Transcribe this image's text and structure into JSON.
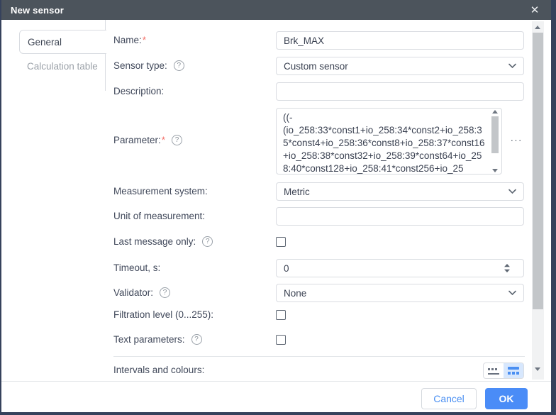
{
  "dialog": {
    "title": "New sensor"
  },
  "icons": {
    "close": "✕",
    "help": "?",
    "more": "···"
  },
  "tabs": [
    {
      "label": "General",
      "active": true
    },
    {
      "label": "Calculation table",
      "active": false
    }
  ],
  "form": {
    "name": {
      "label": "Name:",
      "required": "*",
      "value": "Brk_MAX"
    },
    "sensor_type": {
      "label": "Sensor type:",
      "value": "Custom sensor"
    },
    "description": {
      "label": "Description:",
      "value": ""
    },
    "parameter": {
      "label": "Parameter:",
      "required": "*",
      "value": "((-(io_258:33*const1+io_258:34*const2+io_258:35*const4+io_258:36*const8+io_258:37*const16+io_258:38*const32+io_258:39*const64+io_258:40*const128+io_258:41*const256+io_25"
    },
    "measurement_system": {
      "label": "Measurement system:",
      "value": "Metric"
    },
    "unit": {
      "label": "Unit of measurement:",
      "value": ""
    },
    "last_message_only": {
      "label": "Last message only:",
      "checked": false
    },
    "timeout": {
      "label": "Timeout, s:",
      "value": "0"
    },
    "validator": {
      "label": "Validator:",
      "value": "None"
    },
    "filtration_level": {
      "label": "Filtration level (0...255):",
      "checked": false
    },
    "text_parameters": {
      "label": "Text parameters:",
      "checked": false
    },
    "intervals": {
      "label": "Intervals and colours:"
    }
  },
  "footer": {
    "cancel_label": "Cancel",
    "ok_label": "OK"
  },
  "colors": {
    "accent_blue": "#4a8cf7",
    "required_red": "#f4726b",
    "titlebar": "#4c545c",
    "frame": "#36425c"
  }
}
